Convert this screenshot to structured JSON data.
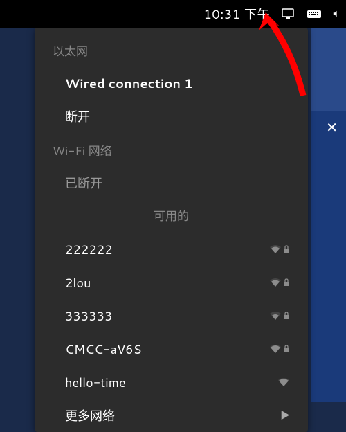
{
  "topbar": {
    "time": "10:31 下午",
    "net_icon": "network-wired-icon",
    "kbd_icon": "keyboard-icon",
    "vol_icon": "volume-icon"
  },
  "menu": {
    "ethernet_header": "以太网",
    "wired_label": "Wired connection 1",
    "disconnect_label": "断开",
    "wifi_header": "Wi-Fi 网络",
    "wifi_status": "已断开",
    "available_header": "可用的",
    "networks": [
      {
        "name": "222222",
        "secure": true
      },
      {
        "name": "2lou",
        "secure": true
      },
      {
        "name": "333333",
        "secure": true
      },
      {
        "name": "CMCC-aV6S",
        "secure": true
      },
      {
        "name": "hello-time",
        "secure": false
      }
    ],
    "more_label": "更多网络"
  }
}
